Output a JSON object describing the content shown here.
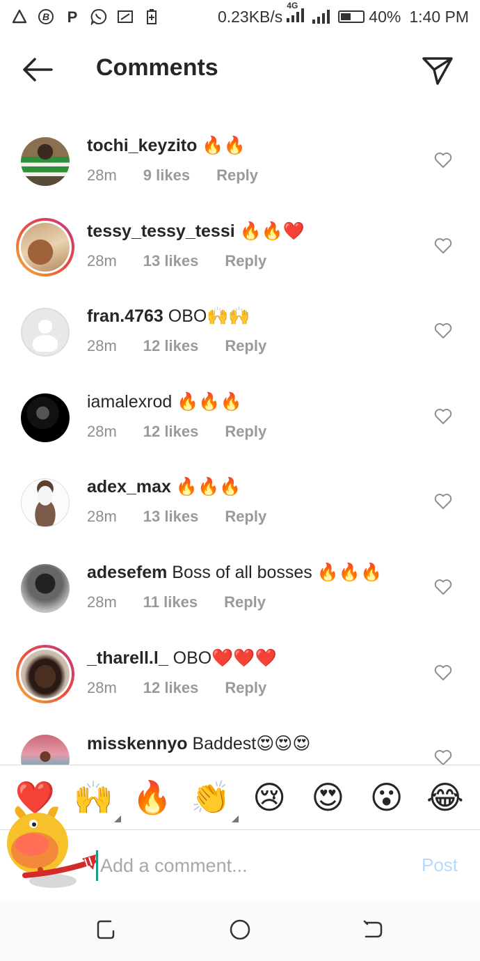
{
  "status_bar": {
    "network_speed": "0.23KB/s",
    "network_type": "4G",
    "battery": "40%",
    "time": "1:40 PM",
    "icons": [
      "triangle-alert-icon",
      "b-app-icon",
      "p-app-icon",
      "whatsapp-icon",
      "screenshot-icon",
      "battery-saver-icon"
    ]
  },
  "header": {
    "title": "Comments",
    "back_icon": "arrow-left-icon",
    "share_icon": "send-icon"
  },
  "comments": [
    {
      "username": "tochi_keyzito",
      "text": " 🔥🔥",
      "time": "28m",
      "likes": "9 likes",
      "reply": "Reply",
      "story_ring": false
    },
    {
      "username": "tessy_tessy_tessi",
      "text": " 🔥🔥❤️",
      "time": "28m",
      "likes": "13 likes",
      "reply": "Reply",
      "story_ring": true
    },
    {
      "username": "fran.4763",
      "text": " OBO🙌🙌",
      "time": "28m",
      "likes": "12 likes",
      "reply": "Reply",
      "story_ring": false
    },
    {
      "username": "iamalexrod",
      "text": " 🔥🔥🔥",
      "time": "28m",
      "likes": "12 likes",
      "reply": "Reply",
      "story_ring": false
    },
    {
      "username": "adex_max",
      "text": " 🔥🔥🔥",
      "time": "28m",
      "likes": "13 likes",
      "reply": "Reply",
      "story_ring": false
    },
    {
      "username": "adesefem",
      "text": " Boss of all bosses 🔥🔥🔥",
      "time": "28m",
      "likes": "11 likes",
      "reply": "Reply",
      "story_ring": false
    },
    {
      "username": "_tharell.l_",
      "text": " OBO❤️❤️❤️",
      "time": "28m",
      "likes": "12 likes",
      "reply": "Reply",
      "story_ring": true
    },
    {
      "username": "misskennyo",
      "text": " Baddest😍😍😍",
      "time": "",
      "likes": "",
      "reply": "",
      "story_ring": false
    }
  ],
  "emoji_bar": [
    {
      "emoji": "❤️",
      "has_more": false
    },
    {
      "emoji": "🙌",
      "has_more": true
    },
    {
      "emoji": "🔥",
      "has_more": false
    },
    {
      "emoji": "👏",
      "has_more": true
    },
    {
      "emoji": "😢",
      "has_more": false
    },
    {
      "emoji": "😍",
      "has_more": false
    },
    {
      "emoji": "😮",
      "has_more": false
    },
    {
      "emoji": "😂",
      "has_more": false
    }
  ],
  "composer": {
    "placeholder": "Add a comment...",
    "post_label": "Post"
  },
  "nav_bar": {
    "icons": [
      "recent-apps-icon",
      "home-icon",
      "back-nav-icon"
    ]
  },
  "colors": {
    "text": "#262626",
    "meta": "#8e8e8e",
    "post_disabled": "#b3dbff",
    "story_ring_start": "#f9b233",
    "story_ring_end": "#c13584"
  }
}
